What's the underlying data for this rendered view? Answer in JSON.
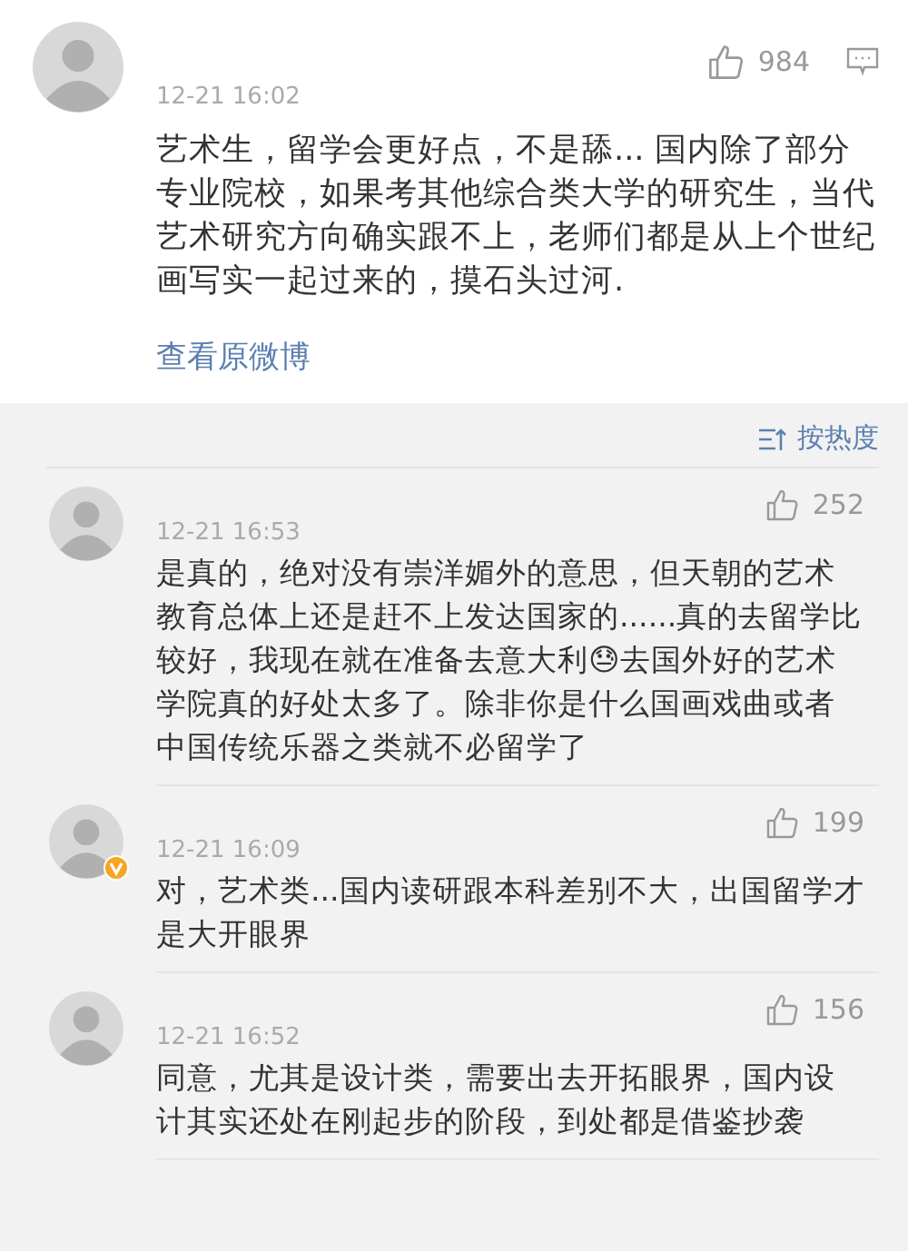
{
  "post": {
    "likes": "984",
    "time": "12-21 16:02",
    "text": "艺术生，留学会更好点，不是舔... 国内除了部分专业院校，如果考其他综合类大学的研究生，当代艺术研究方向确实跟不上，老师们都是从上个世纪画写实一起过来的，摸石头过河.",
    "link": "查看原微博"
  },
  "sort": {
    "label": "按热度"
  },
  "comments": [
    {
      "time": "12-21 16:53",
      "likes": "252",
      "verified": false,
      "text": "是真的，绝对没有崇洋媚外的意思，但天朝的艺术教育总体上还是赶不上发达国家的......真的去留学比较好，我现在就在准备去意大利😓去国外好的艺术学院真的好处太多了。除非你是什么国画戏曲或者中国传统乐器之类就不必留学了"
    },
    {
      "time": "12-21 16:09",
      "likes": "199",
      "verified": true,
      "text": "对，艺术类...国内读研跟本科差别不大，出国留学才是大开眼界"
    },
    {
      "time": "12-21 16:52",
      "likes": "156",
      "verified": false,
      "text": "同意，尤其是设计类，需要出去开拓眼界，国内设计其实还处在刚起步的阶段，到处都是借鉴抄袭"
    }
  ]
}
